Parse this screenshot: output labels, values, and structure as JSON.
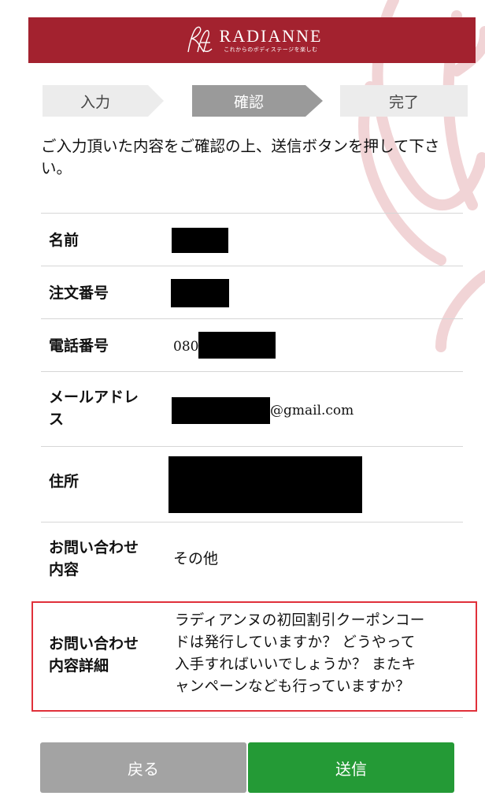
{
  "header": {
    "brand_name": "RADIANNE",
    "tagline": "これからのボディステージを楽しむ",
    "logo_icon": "radianne-monogram-icon",
    "brand_color": "#a3222f"
  },
  "steps": [
    {
      "label": "入力",
      "state": "done"
    },
    {
      "label": "確認",
      "state": "current"
    },
    {
      "label": "完了",
      "state": "todo"
    }
  ],
  "intro": "ご入力頂いた内容をご確認の上、送信ボタンを押して下さい。",
  "fields": {
    "name": {
      "label": "名前",
      "value": ""
    },
    "order_number": {
      "label": "注文番号",
      "value": ""
    },
    "phone": {
      "label": "電話番号",
      "value_prefix": "080"
    },
    "email": {
      "label_line1": "メールアドレ",
      "label_line2": "ス",
      "value_suffix": "@gmail.com"
    },
    "address": {
      "label": "住所",
      "value": ""
    },
    "inquiry_type": {
      "label_line1": "お問い合わせ",
      "label_line2": "内容",
      "value": "その他"
    },
    "inquiry_detail": {
      "label_line1": "お問い合わせ",
      "label_line2": "内容詳細",
      "value_lines": [
        "ラディアンヌの初回割引クーポンコー",
        "ドは発行していますか？ どうやって",
        "入手すればいいでしょうか？ またキ",
        "ャンペーンなども行っていますか？"
      ]
    }
  },
  "buttons": {
    "back_label": "戻る",
    "send_label": "送信",
    "back_color": "#a3a3a3",
    "send_color": "#249a36"
  },
  "highlight_color": "#e0303a"
}
